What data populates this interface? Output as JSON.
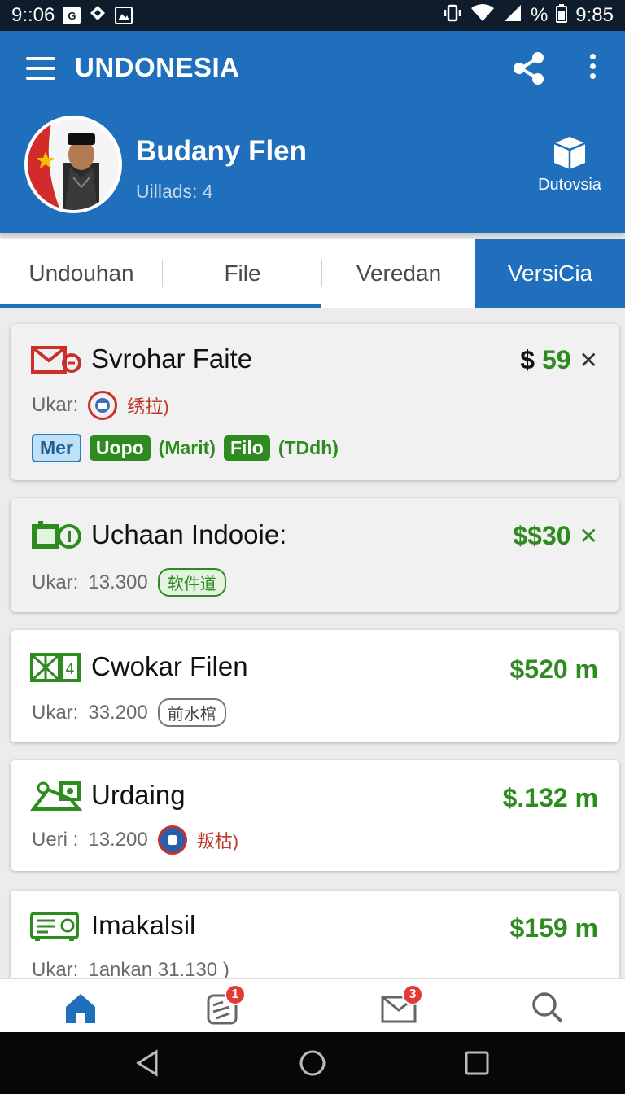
{
  "status_bar": {
    "time_left": "9::06",
    "time_right": "9:85",
    "battery_text": "%",
    "icons": [
      "g-icon",
      "dropbox-icon",
      "image-icon",
      "vibrate-icon",
      "wifi-icon",
      "signal-icon",
      "battery-icon"
    ]
  },
  "app_bar": {
    "title": "UNDONESIA",
    "profile_name": "Budany Flen",
    "profile_sub": "Uillads: 4",
    "download_label": "Dutovsia"
  },
  "tabs": [
    {
      "label": "Undouhan"
    },
    {
      "label": "File"
    },
    {
      "label": "Veredan"
    },
    {
      "label": "VersiCia",
      "active": true
    }
  ],
  "items": [
    {
      "title": "Svrohar Faite",
      "price_symbol": "$",
      "price_value": "59",
      "meta_label": "Ukar:",
      "meta_extra": "绣拉)",
      "tags": [
        "Mer",
        "Uopo",
        "(Marit)",
        "Filo",
        "(TDdh)"
      ]
    },
    {
      "title": "Uchaan Indooie:",
      "price": "$$30",
      "meta_label": "Ukar:",
      "meta_value": "13.300",
      "chip": "软件道"
    },
    {
      "title": "Cwokar Filen",
      "price": "$520 m",
      "meta_label": "Ukar:",
      "meta_value": "33.200",
      "chip": "前水棺"
    },
    {
      "title": "Urdaing",
      "price": "$.132 m",
      "meta_label": "Ueri :",
      "meta_value": "13.200",
      "meta_extra": "叛枯)"
    },
    {
      "title": "Imakalsil",
      "price": "$159 m",
      "meta_label": "Ukar:",
      "meta_value": "1ankan 31.130 )"
    }
  ],
  "bottom_nav": {
    "badge_receipts": "1",
    "badge_inbox": "3"
  },
  "colors": {
    "primary": "#1f6fbc",
    "price_green": "#2e8b1f",
    "badge_red": "#e53935"
  }
}
